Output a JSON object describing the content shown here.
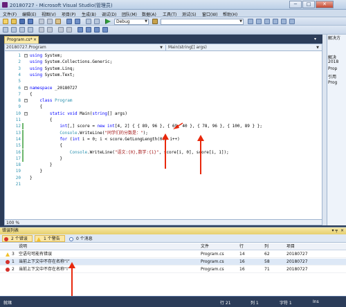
{
  "window": {
    "title": "20180727 - Microsoft Visual Studio(管理员)",
    "min": "−",
    "max": "□",
    "close": "✕"
  },
  "menu": [
    "文件(F)",
    "编辑(E)",
    "视图(V)",
    "项目(P)",
    "生成(B)",
    "调试(D)",
    "团队(M)",
    "数据(A)",
    "工具(T)",
    "测试(S)",
    "窗口(W)",
    "帮助(H)"
  ],
  "toolbar": {
    "config": "Debug",
    "config_arrow": "▼",
    "search_arrow": "▼"
  },
  "editor": {
    "tab": "Program.cs*",
    "tab_close": "×",
    "nav_left": "20180727.Program",
    "nav_right": "Main(string[] args)",
    "zoom": "100 %",
    "lines": [
      {
        "n": "1",
        "parts": [
          {
            "c": "kw",
            "t": "using"
          },
          {
            "c": "",
            "t": " System;"
          }
        ],
        "fold": "−"
      },
      {
        "n": "2",
        "parts": [
          {
            "c": "kw",
            "t": "using"
          },
          {
            "c": "",
            "t": " System.Collections.Generic;"
          }
        ]
      },
      {
        "n": "3",
        "parts": [
          {
            "c": "kw",
            "t": "using"
          },
          {
            "c": "",
            "t": " System.Linq;"
          }
        ]
      },
      {
        "n": "4",
        "parts": [
          {
            "c": "kw",
            "t": "using"
          },
          {
            "c": "",
            "t": " System.Text;"
          }
        ]
      },
      {
        "n": "5",
        "parts": [
          {
            "c": "",
            "t": ""
          }
        ]
      },
      {
        "n": "6",
        "parts": [
          {
            "c": "kw",
            "t": "namespace"
          },
          {
            "c": "",
            "t": " _20180727"
          }
        ],
        "fold": "−"
      },
      {
        "n": "7",
        "parts": [
          {
            "c": "",
            "t": "{"
          }
        ]
      },
      {
        "n": "8",
        "parts": [
          {
            "c": "",
            "t": "    "
          },
          {
            "c": "kw",
            "t": "class"
          },
          {
            "c": "",
            "t": " "
          },
          {
            "c": "ty",
            "t": "Program"
          }
        ],
        "fold": "−"
      },
      {
        "n": "9",
        "parts": [
          {
            "c": "",
            "t": "    {"
          }
        ]
      },
      {
        "n": "10",
        "parts": [
          {
            "c": "",
            "t": "        "
          },
          {
            "c": "kw",
            "t": "static void"
          },
          {
            "c": "",
            "t": " Main("
          },
          {
            "c": "kw",
            "t": "string"
          },
          {
            "c": "",
            "t": "[] args)"
          }
        ],
        "fold": "−"
      },
      {
        "n": "11",
        "parts": [
          {
            "c": "",
            "t": "        {"
          }
        ]
      },
      {
        "n": "12",
        "parts": [
          {
            "c": "",
            "t": "            "
          },
          {
            "c": "kw",
            "t": "int"
          },
          {
            "c": "",
            "t": "[,] score = "
          },
          {
            "c": "kw",
            "t": "new int"
          },
          {
            "c": "",
            "t": "[4, 2] { { 89, 96 }, { 69, 40 }, { 78, 96 }, { 100, 89 } };"
          }
        ],
        "chg": true
      },
      {
        "n": "13",
        "parts": [
          {
            "c": "",
            "t": "            "
          },
          {
            "c": "ty",
            "t": "Console"
          },
          {
            "c": "",
            "t": ".WriteLine("
          },
          {
            "c": "st",
            "t": "\"同学们的分数是：\""
          },
          {
            "c": "",
            "t": ");"
          }
        ],
        "chg": true
      },
      {
        "n": "14",
        "parts": [
          {
            "c": "",
            "t": "            "
          },
          {
            "c": "kw",
            "t": "for"
          },
          {
            "c": "",
            "t": " ("
          },
          {
            "c": "kw",
            "t": "int"
          },
          {
            "c": "",
            "t": " i = 0; i < score.GetLongLength(0); i++)"
          }
        ],
        "chg": true
      },
      {
        "n": "15",
        "parts": [
          {
            "c": "",
            "t": "            {"
          }
        ],
        "chg": true
      },
      {
        "n": "16",
        "parts": [
          {
            "c": "",
            "t": "                "
          },
          {
            "c": "ty",
            "t": "Console"
          },
          {
            "c": "",
            "t": ".WriteLine("
          },
          {
            "c": "st",
            "t": "\"语文:{0},数学:{1}\""
          },
          {
            "c": "",
            "t": ", score[i, 0], score[i, 1]);"
          }
        ],
        "chg": true
      },
      {
        "n": "17",
        "parts": [
          {
            "c": "",
            "t": "            }"
          }
        ],
        "chg": true
      },
      {
        "n": "18",
        "parts": [
          {
            "c": "",
            "t": "        }"
          }
        ]
      },
      {
        "n": "19",
        "parts": [
          {
            "c": "",
            "t": "    }"
          }
        ]
      },
      {
        "n": "20",
        "parts": [
          {
            "c": "",
            "t": "}"
          }
        ]
      },
      {
        "n": "21",
        "parts": [
          {
            "c": "",
            "t": ""
          }
        ]
      }
    ]
  },
  "right_panel": [
    "解决方",
    "解决",
    "2018",
    "Prop",
    "引用",
    "Prog"
  ],
  "error_list": {
    "title": "错误列表",
    "pin": "▾ ╤",
    "close": "×",
    "filters": {
      "errors": "2 个错误",
      "warnings": "1 个警告",
      "messages": "0 个消息"
    },
    "columns": {
      "desc": "说明",
      "file": "文件",
      "line": "行",
      "col": "列",
      "project": "项目"
    },
    "rows": [
      {
        "num": "3",
        "type": "warn",
        "desc": "空语句可能有错误",
        "file": "Program.cs",
        "line": "14",
        "col": "62",
        "project": "20180727"
      },
      {
        "num": "1",
        "type": "err",
        "desc": "当前上下文中不存在名称“i”",
        "file": "Program.cs",
        "line": "16",
        "col": "58",
        "project": "20180727"
      },
      {
        "num": "2",
        "type": "err",
        "desc": "当前上下文中不存在名称“i”",
        "file": "Program.cs",
        "line": "16",
        "col": "71",
        "project": "20180727"
      }
    ]
  },
  "status": {
    "ready": "就绪",
    "line": "行 21",
    "col": "列 1",
    "ch": "字符 1",
    "ins": "Ins"
  },
  "colors": {
    "arrow": "#e8280c",
    "accent": "#2b3c59"
  }
}
